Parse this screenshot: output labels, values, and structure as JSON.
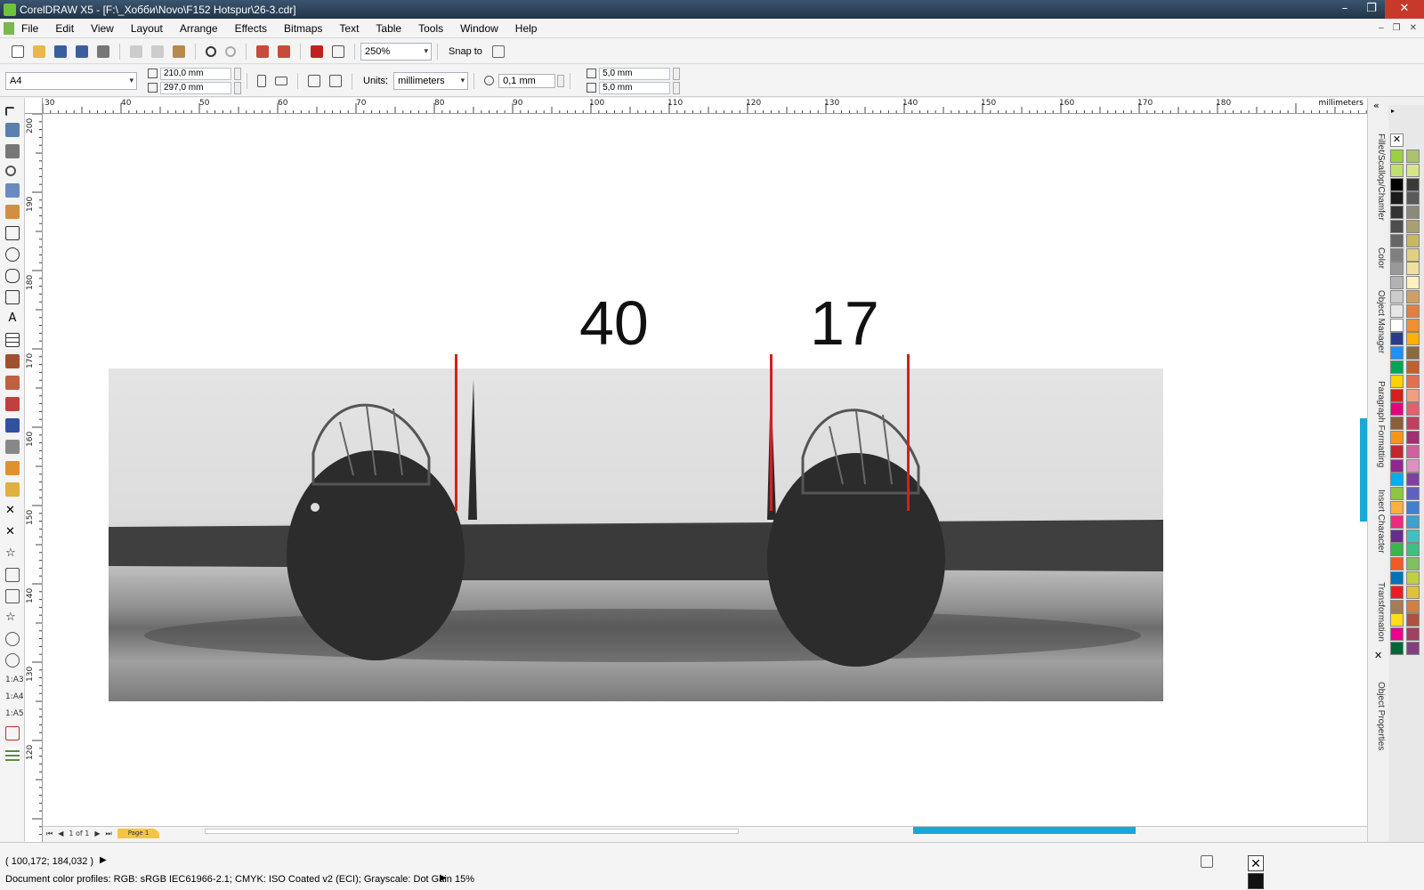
{
  "window": {
    "title": "CorelDRAW X5 - [F:\\_Хобби\\Novo\\F152 Hotspur\\26-3.cdr]",
    "controls": [
      "–",
      "❐",
      "✕"
    ]
  },
  "menu": {
    "items": [
      "File",
      "Edit",
      "View",
      "Layout",
      "Arrange",
      "Effects",
      "Bitmaps",
      "Text",
      "Table",
      "Tools",
      "Window",
      "Help"
    ],
    "mdi_controls": [
      "–",
      "❐",
      "✕"
    ]
  },
  "toolbar": {
    "zoom": "250%",
    "snap_label": "Snap to"
  },
  "propbar": {
    "page_size": "A4",
    "width": "210,0 mm",
    "height": "297,0 mm",
    "units_label": "Units:",
    "units_value": "millimeters",
    "nudge": "0,1 mm",
    "dup_x": "5,0 mm",
    "dup_y": "5,0 mm"
  },
  "ruler": {
    "unit": "millimeters",
    "top_labels": [
      "30",
      "40",
      "50",
      "60",
      "70",
      "80",
      "90",
      "100",
      "110",
      "120",
      "130",
      "140",
      "150",
      "160",
      "170",
      "180"
    ],
    "left_labels": [
      "200",
      "190",
      "180",
      "170",
      "160",
      "150",
      "140",
      "130",
      "120"
    ]
  },
  "canvas": {
    "label_left": "40",
    "label_right": "17"
  },
  "pages": {
    "indicator": "1 of 1",
    "tab": "Page 1"
  },
  "dockers": [
    "Fillet/Scallop/Chamfer",
    "Color",
    "Object Manager",
    "Paragraph Formatting",
    "Insert Character",
    "Transformation",
    "Object Properties"
  ],
  "palette": {
    "colors": [
      "#9bd040",
      "#bfe070",
      "#000000",
      "#1a1a1a",
      "#333333",
      "#4d4d4d",
      "#666666",
      "#808080",
      "#999999",
      "#b3b3b3",
      "#cccccc",
      "#e6e6e6",
      "#ffffff",
      "#2a3b8f",
      "#1e90ff",
      "#00a651",
      "#ffd200",
      "#d3201c",
      "#e6007e",
      "#8b5e3c",
      "#f7941d",
      "#c1272d",
      "#92278f",
      "#00aeef",
      "#8dc63f",
      "#fbb040",
      "#ee2a7b",
      "#662d91",
      "#39b54a",
      "#f15a24",
      "#0072bc",
      "#ed1c24",
      "#a67c52",
      "#ffde17",
      "#ec008c",
      "#006838"
    ],
    "colors_right": [
      "#a8c36a",
      "#d8e68a",
      "#3a3a3a",
      "#5a5a5a",
      "#8a8a7a",
      "#a8a070",
      "#c8b860",
      "#e0d080",
      "#f0e0a0",
      "#fff0c0",
      "#d0a060",
      "#e08040",
      "#f09030",
      "#ffb000",
      "#8a6a40",
      "#c06030",
      "#e07050",
      "#f0a080",
      "#e06070",
      "#c04060",
      "#a03070",
      "#d060a0",
      "#e090c0",
      "#8040a0",
      "#6060c0",
      "#4080d0",
      "#40a0d0",
      "#40c0c0",
      "#40c080",
      "#80c060",
      "#c0d040",
      "#e0c040",
      "#d08040",
      "#b05040",
      "#a04060",
      "#804080"
    ]
  },
  "status": {
    "coords": "( 100,172; 184,032 )",
    "profile": "Document color profiles: RGB: sRGB IEC61966-2.1; CMYK: ISO Coated v2 (ECI); Grayscale: Dot Gain 15%"
  }
}
